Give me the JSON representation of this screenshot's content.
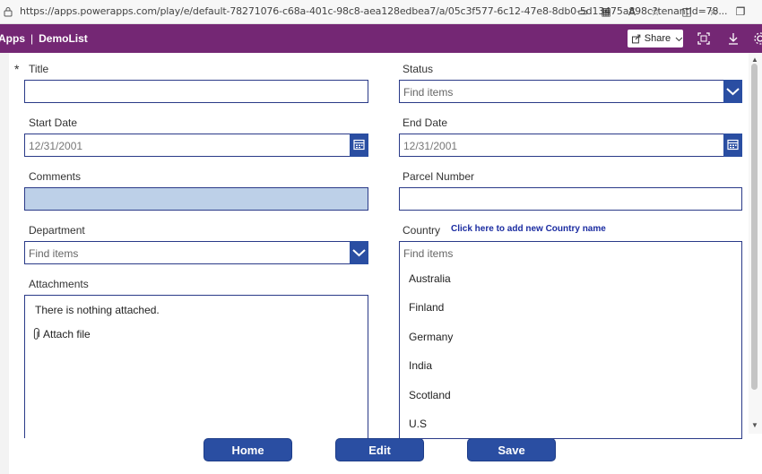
{
  "browser": {
    "url": "https://apps.powerapps.com/play/e/default-78271076-c68a-401c-98c8-aea128edbea7/a/05c3f577-6c12-47e8-8db0-5d13475a898c?tenantId=78..."
  },
  "header": {
    "app_prefix": "Apps",
    "separator": "|",
    "app_name": "DemoList",
    "share_label": "Share",
    "bg_color": "#742774"
  },
  "form": {
    "required_mark": "*",
    "title_label": "Title",
    "title_value": "",
    "status_label": "Status",
    "status_placeholder": "Find items",
    "start_date_label": "Start Date",
    "start_date_value": "12/31/2001",
    "end_date_label": "End Date",
    "end_date_value": "12/31/2001",
    "comments_label": "Comments",
    "comments_value": "",
    "parcel_label": "Parcel Number",
    "parcel_value": "",
    "department_label": "Department",
    "department_placeholder": "Find items",
    "country_label": "Country",
    "country_placeholder": "Find items",
    "country_add_link": "Click here to add new Country name",
    "country_options": [
      "Australia",
      "Finland",
      "Germany",
      "India",
      "Scotland",
      "U.S"
    ],
    "attachments_label": "Attachments",
    "attachments_empty": "There is nothing attached.",
    "attach_file_label": "Attach file"
  },
  "buttons": {
    "home": "Home",
    "edit": "Edit",
    "save": "Save",
    "color": "#2a4ea2"
  }
}
